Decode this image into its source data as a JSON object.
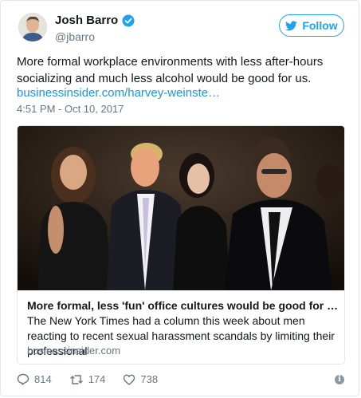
{
  "author": {
    "name": "Josh Barro",
    "handle": "@jbarro"
  },
  "follow_button": {
    "label": "Follow",
    "icon": "twitter-bird-icon"
  },
  "tweet": {
    "text": "More formal workplace environments with less after-hours socializing and much less alcohol would be good for us.",
    "link": "businessinsider.com/harvey-weinste…",
    "timestamp": "4:51 PM - Oct 10, 2017"
  },
  "card": {
    "title": "More formal, less 'fun' office cultures would be good for all of …",
    "description": "The New York Times had a column this week about men reacting to recent sexual harassment scandals by limiting their professional",
    "domain": "businessinsider.com"
  },
  "actions": {
    "replies": "814",
    "retweets": "174",
    "likes": "738"
  },
  "colors": {
    "accent": "#1da1f2",
    "link": "#1b95e0",
    "muted": "#657786"
  }
}
